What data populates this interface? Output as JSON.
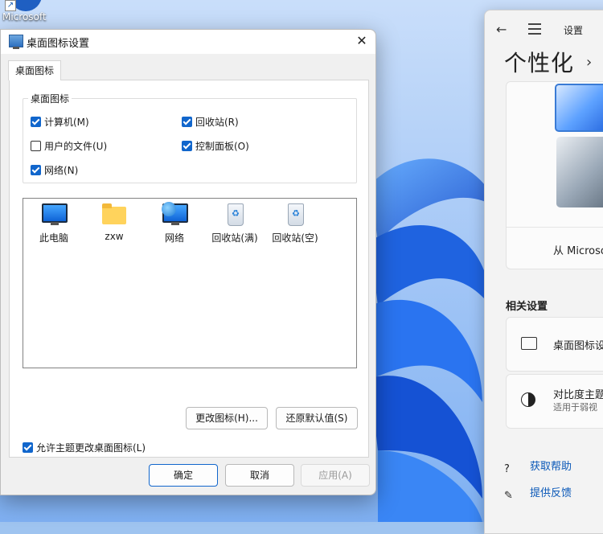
{
  "desktop": {
    "shortcut_label": "Microsoft"
  },
  "settings": {
    "app_title": "设置",
    "heading": "个性化",
    "from_text": "从 Microsoft",
    "section_title": "相关设置",
    "rows": [
      {
        "label": "桌面图标设"
      },
      {
        "label": "对比度主题",
        "sub": "适用于弱视"
      }
    ],
    "links": [
      {
        "label": "获取帮助"
      },
      {
        "label": "提供反馈"
      }
    ]
  },
  "dialog": {
    "title": "桌面图标设置",
    "tab": "桌面图标",
    "group_title": "桌面图标",
    "checkboxes": [
      {
        "label": "计算机(M)",
        "checked": true
      },
      {
        "label": "回收站(R)",
        "checked": true
      },
      {
        "label": "用户的文件(U)",
        "checked": false
      },
      {
        "label": "控制面板(O)",
        "checked": true
      },
      {
        "label": "网络(N)",
        "checked": true
      }
    ],
    "icons": [
      {
        "label": "此电脑",
        "icon": "monitor-icon"
      },
      {
        "label": "zxw",
        "icon": "folder-icon"
      },
      {
        "label": "网络",
        "icon": "network-icon"
      },
      {
        "label": "回收站(满)",
        "icon": "recycle-bin-full-icon"
      },
      {
        "label": "回收站(空)",
        "icon": "recycle-bin-empty-icon"
      }
    ],
    "change_icon_button": "更改图标(H)...",
    "restore_default_button": "还原默认值(S)",
    "allow_themes": {
      "label": "允许主题更改桌面图标(L)",
      "checked": true
    },
    "ok_button": "确定",
    "cancel_button": "取消",
    "apply_button": "应用(A)"
  },
  "colors": {
    "accent": "#1166cc",
    "link": "#0a58b8"
  }
}
